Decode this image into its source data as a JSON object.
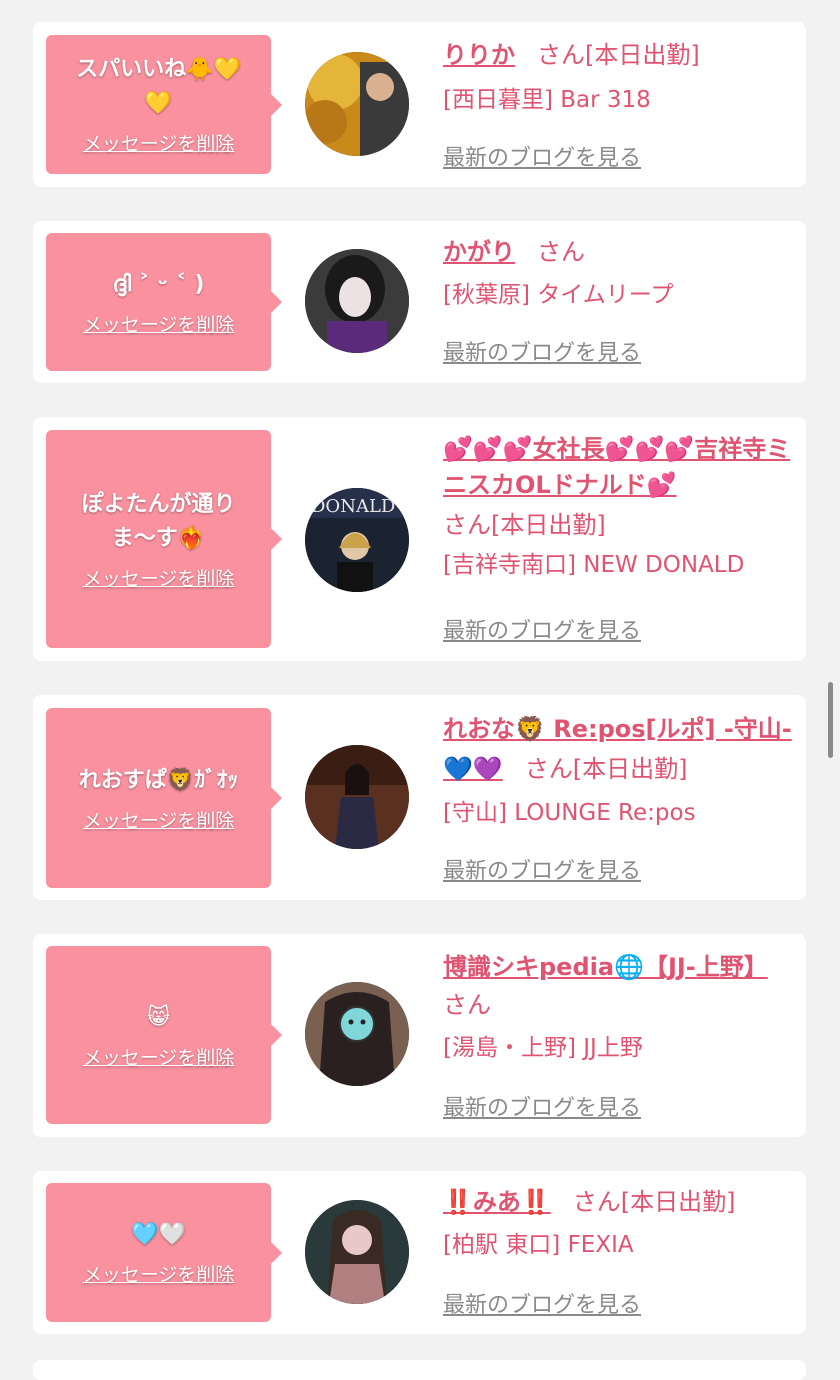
{
  "delete_label": "メッセージを削除",
  "blog_label": "最新のブログを見る",
  "items": [
    {
      "message_lines": [
        "スパいいね🐥💛",
        "💛"
      ],
      "name": "りりか",
      "suffix": "さん[本日出勤]",
      "shop": "[西日暮里] Bar 318",
      "avatar_colors": [
        "#c98a1a",
        "#e5b53a",
        "#3a3a3a"
      ]
    },
    {
      "message_lines": [
        "ദ്ദി ˃ ᵕ ˂ )"
      ],
      "name": "かがり",
      "suffix": "さん",
      "shop": "[秋葉原] タイムリープ",
      "avatar_colors": [
        "#2b2b2b",
        "#e8e0e4",
        "#5a2b7a"
      ]
    },
    {
      "message_lines": [
        "ぽよたんが通り",
        "ま〜す❤️‍🔥"
      ],
      "name": "💕💕💕女社長💕💕💕吉祥寺ミニスカOLドナルド💕",
      "suffix": "さん[本日出勤]",
      "shop": "[吉祥寺南口] NEW DONALD",
      "avatar_colors": [
        "#1b2230",
        "#e0c8a8",
        "#caa24a"
      ]
    },
    {
      "message_lines": [
        "れおすぱ🦁ｶﾞｵｯ"
      ],
      "name": "れおな🦁 Re:pos[ルポ] -守山-💙💜",
      "suffix": "さん[本日出勤]",
      "shop": "[守山] LOUNGE Re:pos",
      "avatar_colors": [
        "#5a3020",
        "#2a2a44",
        "#e8c0a0"
      ]
    },
    {
      "message_lines": [
        "😸"
      ],
      "name": "博識シキpedia🌐【JJ-上野】",
      "suffix": "さん",
      "shop": "[湯島・上野] JJ上野",
      "avatar_colors": [
        "#6a5040",
        "#a89080",
        "#7fd7d7"
      ]
    },
    {
      "message_lines": [
        "🩵🤍"
      ],
      "name": "‼️みあ‼️",
      "suffix": "さん[本日出勤]",
      "shop": "[柏駅 東口] FEXIA",
      "avatar_colors": [
        "#2a3a3a",
        "#e8c8c8",
        "#b08080"
      ]
    }
  ]
}
